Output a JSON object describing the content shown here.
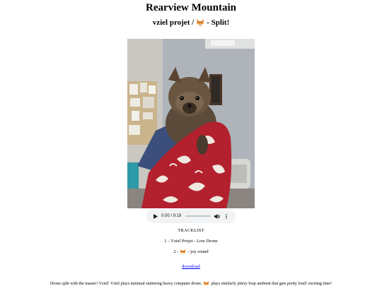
{
  "site_title": "Rearview Mountain",
  "release": {
    "artist": "vziel projet /",
    "title_suffix": "- Split!",
    "emoji": "fox-emoji"
  },
  "photo": {
    "subject": "fox-kit-photo"
  },
  "player": {
    "time": "0:00 / 9:19",
    "progress": 0,
    "icons": [
      "play-icon",
      "volume-icon",
      "more-options-icon"
    ]
  },
  "tracklist": {
    "heading": "TRACKLIST",
    "tracks": [
      {
        "number_prefix": "1 - ",
        "text": "Vziel Projet - Low Drone"
      },
      {
        "number_prefix": "2 - ",
        "text": " - joy sound"
      }
    ]
  },
  "download": {
    "label": "download"
  },
  "description": {
    "part1": "Drone split with the master! Vziel! Vziel plays minimal stuttering heavy computer drone,",
    "part2": "plays similarly jittery loop ambient that gets pretty loud! exciting time!"
  },
  "colors": {
    "link": "#0000ee",
    "player_bg": "#f1f3f4",
    "fox_orange": "#f08a24"
  }
}
